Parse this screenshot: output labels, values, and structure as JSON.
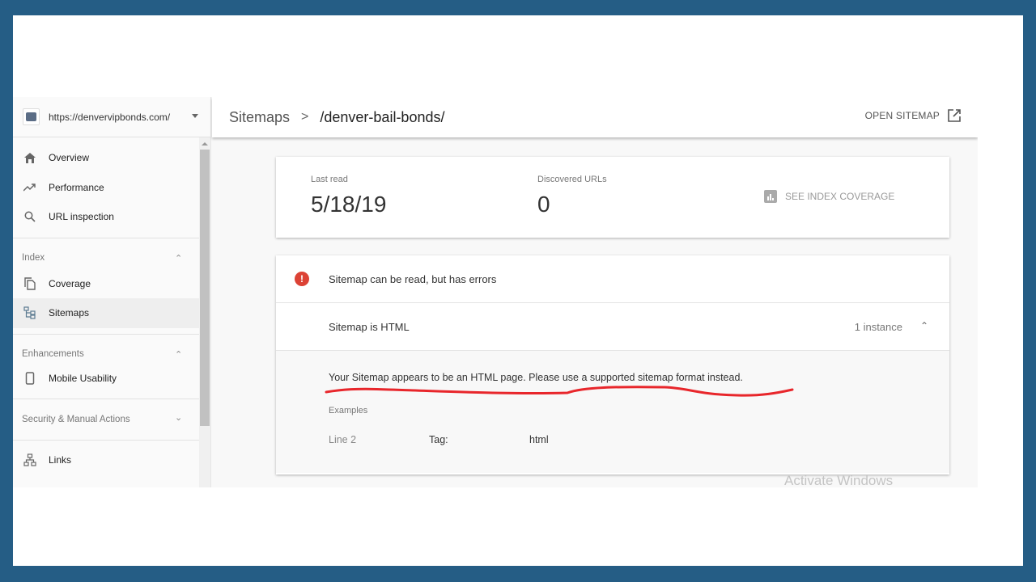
{
  "property": {
    "url": "https://denvervipbonds.com/"
  },
  "sidebar": {
    "items": [
      {
        "label": "Overview",
        "icon": "home-icon"
      },
      {
        "label": "Performance",
        "icon": "trending-up-icon"
      },
      {
        "label": "URL inspection",
        "icon": "search-icon"
      }
    ],
    "sections": [
      {
        "label": "Index",
        "expanded": true,
        "items": [
          {
            "label": "Coverage",
            "icon": "copy-icon"
          },
          {
            "label": "Sitemaps",
            "icon": "sitemap-icon",
            "active": true
          }
        ]
      },
      {
        "label": "Enhancements",
        "expanded": true,
        "items": [
          {
            "label": "Mobile Usability",
            "icon": "phone-icon"
          }
        ]
      },
      {
        "label": "Security & Manual Actions",
        "expanded": false,
        "items": []
      }
    ],
    "links": {
      "label": "Links",
      "icon": "network-icon"
    }
  },
  "header": {
    "breadcrumb_root": "Sitemaps",
    "breadcrumb_sep": ">",
    "breadcrumb_current": "/denver-bail-bonds/",
    "open_sitemap": "OPEN SITEMAP"
  },
  "stats": {
    "last_read_label": "Last read",
    "last_read_value": "5/18/19",
    "discovered_label": "Discovered URLs",
    "discovered_value": "0",
    "see_index_coverage": "SEE INDEX COVERAGE"
  },
  "issues": {
    "status": "Sitemap can be read, but has errors",
    "issue_title": "Sitemap is HTML",
    "instance_count": "1 instance",
    "message": "Your Sitemap appears to be an HTML page. Please use a supported sitemap format instead.",
    "examples_label": "Examples",
    "example": {
      "line": "Line 2",
      "tag_label": "Tag:",
      "tag_value": "html"
    }
  },
  "colors": {
    "frame": "#255d85",
    "error": "#dc4235",
    "annotation": "#e8262b"
  },
  "watermark": "Activate Windows"
}
